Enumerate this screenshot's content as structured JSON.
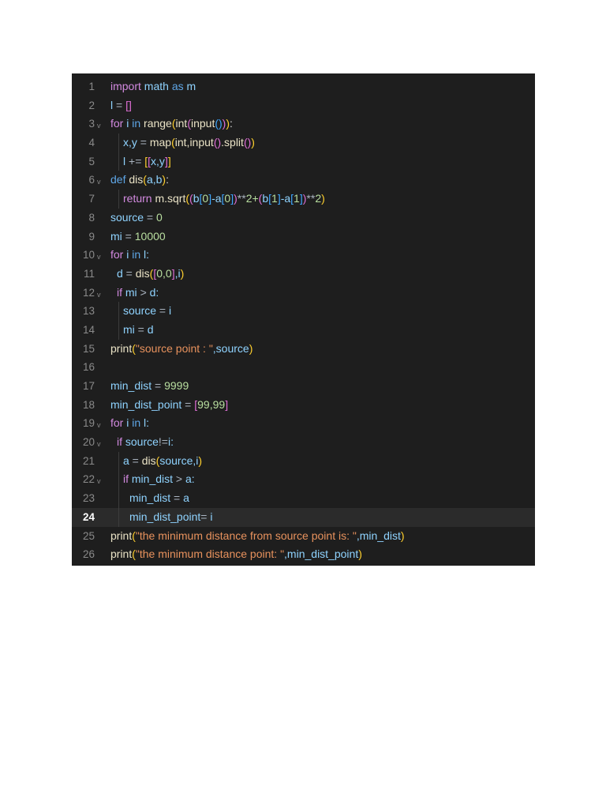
{
  "editor": {
    "active_line": 24,
    "lines": [
      {
        "n": 1,
        "indent": 0,
        "tokens": [
          [
            "import",
            "k"
          ],
          [
            " math ",
            "v"
          ],
          [
            "as",
            "m"
          ],
          [
            " m",
            "v"
          ]
        ]
      },
      {
        "n": 2,
        "indent": 0,
        "tokens": [
          [
            "l",
            "v"
          ],
          [
            " = ",
            "o"
          ],
          [
            "[]",
            "b2"
          ]
        ]
      },
      {
        "n": 3,
        "indent": 0,
        "fold": true,
        "tokens": [
          [
            "for",
            "k"
          ],
          [
            " i ",
            "v"
          ],
          [
            "in",
            "m"
          ],
          [
            " range",
            "f"
          ],
          [
            "(",
            "b1"
          ],
          [
            "int",
            "f"
          ],
          [
            "(",
            "b2"
          ],
          [
            "input",
            "f"
          ],
          [
            "()",
            "b3"
          ],
          [
            ")",
            "b2"
          ],
          [
            ")",
            "b1"
          ],
          [
            ":",
            "p"
          ]
        ]
      },
      {
        "n": 4,
        "indent": 2,
        "tokens": [
          [
            "x,y",
            "v"
          ],
          [
            " = ",
            "o"
          ],
          [
            "map",
            "f"
          ],
          [
            "(",
            "b1"
          ],
          [
            "int,input",
            "f"
          ],
          [
            "()",
            "b2"
          ],
          [
            ".split",
            "f"
          ],
          [
            "()",
            "b2"
          ],
          [
            ")",
            "b1"
          ]
        ]
      },
      {
        "n": 5,
        "indent": 2,
        "tokens": [
          [
            "l",
            "v"
          ],
          [
            " += ",
            "o"
          ],
          [
            "[",
            "b1"
          ],
          [
            "[",
            "b2"
          ],
          [
            "x,y",
            "v"
          ],
          [
            "]",
            "b2"
          ],
          [
            "]",
            "b1"
          ]
        ]
      },
      {
        "n": 6,
        "indent": 0,
        "fold": true,
        "tokens": [
          [
            "def",
            "kd"
          ],
          [
            " dis",
            "f"
          ],
          [
            "(",
            "b1"
          ],
          [
            "a,b",
            "v"
          ],
          [
            ")",
            "b1"
          ],
          [
            ":",
            "p"
          ]
        ]
      },
      {
        "n": 7,
        "indent": 2,
        "tokens": [
          [
            "return",
            "k"
          ],
          [
            " m.sqrt",
            "f"
          ],
          [
            "(",
            "b1"
          ],
          [
            "(",
            "b2"
          ],
          [
            "b",
            "v"
          ],
          [
            "[",
            "b3"
          ],
          [
            "0",
            "n"
          ],
          [
            "]",
            "b3"
          ],
          [
            "-a",
            "v"
          ],
          [
            "[",
            "b3"
          ],
          [
            "0",
            "n"
          ],
          [
            "]",
            "b3"
          ],
          [
            ")",
            "b2"
          ],
          [
            "**",
            "o"
          ],
          [
            "2+",
            "n"
          ],
          [
            "(",
            "b2"
          ],
          [
            "b",
            "v"
          ],
          [
            "[",
            "b3"
          ],
          [
            "1",
            "n"
          ],
          [
            "]",
            "b3"
          ],
          [
            "-a",
            "v"
          ],
          [
            "[",
            "b3"
          ],
          [
            "1",
            "n"
          ],
          [
            "]",
            "b3"
          ],
          [
            ")",
            "b2"
          ],
          [
            "**",
            "o"
          ],
          [
            "2",
            "n"
          ],
          [
            ")",
            "b1"
          ]
        ]
      },
      {
        "n": 8,
        "indent": 0,
        "tokens": [
          [
            "source",
            "v"
          ],
          [
            " = ",
            "o"
          ],
          [
            "0",
            "n"
          ]
        ]
      },
      {
        "n": 9,
        "indent": 0,
        "tokens": [
          [
            "mi",
            "v"
          ],
          [
            " = ",
            "o"
          ],
          [
            "10000",
            "n"
          ]
        ]
      },
      {
        "n": 10,
        "indent": 0,
        "fold": true,
        "tokens": [
          [
            "for",
            "k"
          ],
          [
            " i ",
            "v"
          ],
          [
            "in",
            "m"
          ],
          [
            " l:",
            "v"
          ]
        ]
      },
      {
        "n": 11,
        "indent": 1,
        "tokens": [
          [
            "d",
            "v"
          ],
          [
            " = ",
            "o"
          ],
          [
            "dis",
            "f"
          ],
          [
            "(",
            "b1"
          ],
          [
            "[",
            "b2"
          ],
          [
            "0,0",
            "n"
          ],
          [
            "]",
            "b2"
          ],
          [
            ",i",
            "v"
          ],
          [
            ")",
            "b1"
          ]
        ]
      },
      {
        "n": 12,
        "indent": 1,
        "fold": true,
        "tokens": [
          [
            "if",
            "k"
          ],
          [
            " mi ",
            "v"
          ],
          [
            "> ",
            "o"
          ],
          [
            "d:",
            "v"
          ]
        ]
      },
      {
        "n": 13,
        "indent": 2,
        "tokens": [
          [
            "source",
            "v"
          ],
          [
            " = ",
            "o"
          ],
          [
            "i",
            "v"
          ]
        ]
      },
      {
        "n": 14,
        "indent": 2,
        "tokens": [
          [
            "mi",
            "v"
          ],
          [
            " = ",
            "o"
          ],
          [
            "d",
            "v"
          ]
        ]
      },
      {
        "n": 15,
        "indent": 0,
        "tokens": [
          [
            "print",
            "f"
          ],
          [
            "(",
            "b1"
          ],
          [
            "\"source point : \"",
            "s"
          ],
          [
            ",source",
            "v"
          ],
          [
            ")",
            "b1"
          ]
        ]
      },
      {
        "n": 16,
        "indent": 0,
        "tokens": []
      },
      {
        "n": 17,
        "indent": 0,
        "tokens": [
          [
            "min_dist",
            "v"
          ],
          [
            " = ",
            "o"
          ],
          [
            "9999",
            "n"
          ]
        ]
      },
      {
        "n": 18,
        "indent": 0,
        "tokens": [
          [
            "min_dist_point",
            "v"
          ],
          [
            " = ",
            "o"
          ],
          [
            "[",
            "b2"
          ],
          [
            "99,99",
            "n"
          ],
          [
            "]",
            "b2"
          ]
        ]
      },
      {
        "n": 19,
        "indent": 0,
        "fold": true,
        "tokens": [
          [
            "for",
            "k"
          ],
          [
            " i ",
            "v"
          ],
          [
            "in",
            "m"
          ],
          [
            " l:",
            "v"
          ]
        ]
      },
      {
        "n": 20,
        "indent": 1,
        "fold": true,
        "tokens": [
          [
            "if",
            "k"
          ],
          [
            " source",
            "v"
          ],
          [
            "!=",
            "o"
          ],
          [
            "i:",
            "v"
          ]
        ]
      },
      {
        "n": 21,
        "indent": 2,
        "tokens": [
          [
            "a",
            "v"
          ],
          [
            " = ",
            "o"
          ],
          [
            "dis",
            "f"
          ],
          [
            "(",
            "b1"
          ],
          [
            "source,i",
            "v"
          ],
          [
            ")",
            "b1"
          ]
        ]
      },
      {
        "n": 22,
        "indent": 2,
        "fold": true,
        "tokens": [
          [
            "if",
            "k"
          ],
          [
            " min_dist ",
            "v"
          ],
          [
            "> ",
            "o"
          ],
          [
            "a:",
            "v"
          ]
        ]
      },
      {
        "n": 23,
        "indent": 3,
        "tokens": [
          [
            "min_dist",
            "v"
          ],
          [
            " = ",
            "o"
          ],
          [
            "a",
            "v"
          ]
        ]
      },
      {
        "n": 24,
        "indent": 3,
        "tokens": [
          [
            "min_dist_point",
            "v"
          ],
          [
            "= ",
            "o"
          ],
          [
            "i",
            "v"
          ]
        ]
      },
      {
        "n": 25,
        "indent": 0,
        "tokens": [
          [
            "print",
            "f"
          ],
          [
            "(",
            "b1"
          ],
          [
            "\"the minimum distance from source point is: \"",
            "s"
          ],
          [
            ",min_dist",
            "v"
          ],
          [
            ")",
            "b1"
          ]
        ]
      },
      {
        "n": 26,
        "indent": 0,
        "tokens": [
          [
            "print",
            "f"
          ],
          [
            "(",
            "b1"
          ],
          [
            "\"the minimum distance point: \"",
            "s"
          ],
          [
            ",min_dist_point",
            "v"
          ],
          [
            ")",
            "b1"
          ]
        ]
      }
    ]
  }
}
